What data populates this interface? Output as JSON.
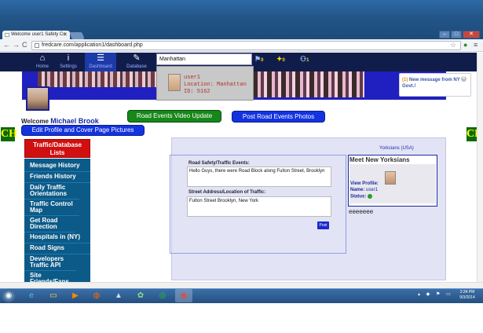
{
  "browser": {
    "tab_title": "Welcome user1 Safety Co",
    "url": "fredcare.com/application1/dashboard.php"
  },
  "nav": {
    "items": [
      {
        "label": "Home",
        "icon": "home-icon"
      },
      {
        "label": "Settings",
        "icon": "info-icon"
      },
      {
        "label": "Dashboard",
        "icon": "list-icon"
      },
      {
        "label": "Database",
        "icon": "wrench-icon"
      }
    ],
    "search_value": "Manhattan",
    "counters": [
      "0",
      "0",
      "1"
    ]
  },
  "search_result": {
    "line1": "user1",
    "line2": "Location: Manhattan",
    "line3": "ID: 5162"
  },
  "notification": {
    "count": "(1)",
    "text": "New message from NY Govt.!"
  },
  "profile": {
    "welcome_label": "Welcome",
    "name": "Michael Brook",
    "edit_button": "Edit Profile and Cover Page Pictures"
  },
  "buttons": {
    "video_update": "Road Events Video Update",
    "post_photos": "Post Road Events Photos"
  },
  "ch_badge": "CH",
  "sidebar": {
    "header": "Traffic/Database Lists",
    "items": [
      "Message History",
      "Friends History",
      "Daily Traffic Orientations",
      "Traffic Control Map",
      "Get Road Direction",
      "Hospitals in (NY)",
      "Road Signs",
      "Developers Traffic API",
      "Site Friends/Fans API"
    ]
  },
  "main": {
    "location_tag": "Yorksians (USA)",
    "form": {
      "label_events": "Road Safety/Traffic Events:",
      "events_text": "Hello Guys, there were Road Block along Fulton Street, Brooklyn",
      "label_address": "Street Address/Location of Traffic:",
      "address_text": "Fulton Street Brooklyn, New York",
      "post_button": "Post"
    },
    "meet": {
      "title": "Meet New Yorksians",
      "view_profile_label": "View Profile:",
      "name_label": "Name:",
      "name_value": "user1",
      "status_label": "Status:"
    },
    "footer_text": "eeeeeee"
  },
  "taskbar": {
    "time": "2:34 PM",
    "date": "9/3/2014"
  }
}
